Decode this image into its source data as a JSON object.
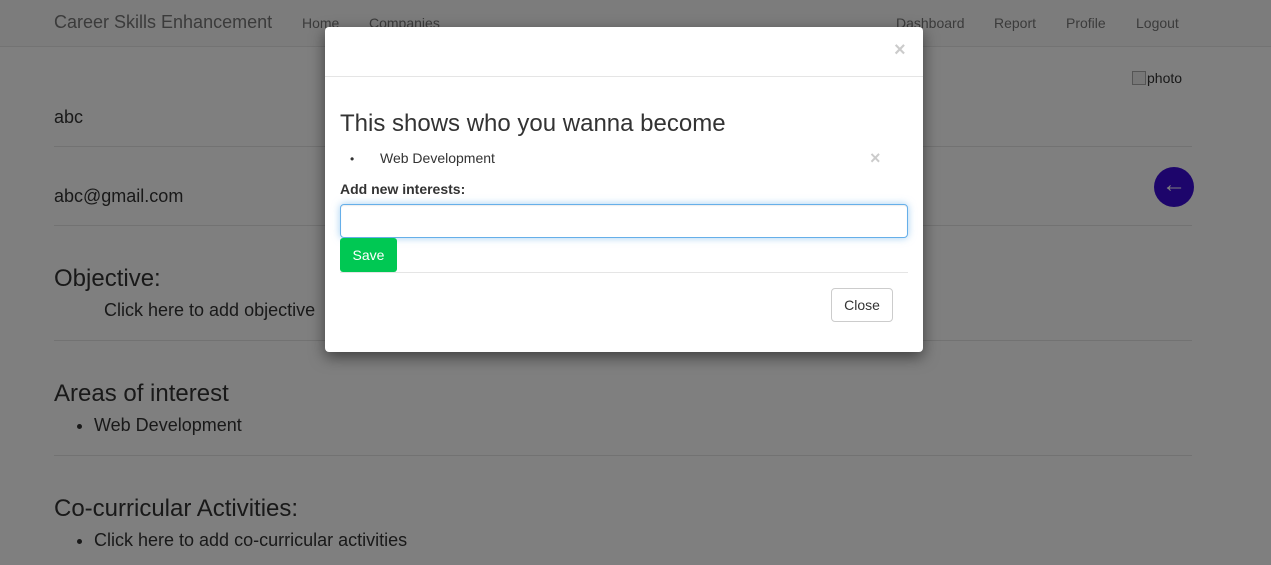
{
  "navbar": {
    "brand": "Career Skills Enhancement",
    "left_links": [
      "Home",
      "Companies"
    ],
    "right_links": [
      "Dashboard",
      "Report",
      "Profile",
      "Logout"
    ]
  },
  "profile": {
    "photo_alt": "photo",
    "name": "abc",
    "email": "abc@gmail.com",
    "back_icon": "←",
    "back_color": "#3b0bd6"
  },
  "sections": {
    "objective_title": "Objective:",
    "objective_link": "Click here to add objective",
    "interests_title": "Areas of interest",
    "interests": [
      "Web Development"
    ],
    "cocurricular_title": "Co-curricular Activities:",
    "cocurricular_link": "Click here to add co-curricular activities"
  },
  "modal": {
    "close_icon": "×",
    "title": "This shows who you wanna become",
    "interests": [
      "Web Development"
    ],
    "remove_icon": "×",
    "add_label": "Add new interests:",
    "input_value": "",
    "save_label": "Save",
    "save_color": "#00c853",
    "close_label": "Close"
  }
}
